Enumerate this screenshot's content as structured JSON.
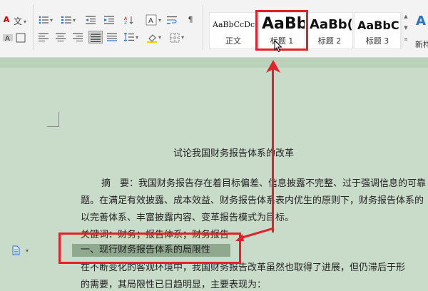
{
  "ribbon": {
    "style_gallery": [
      {
        "preview": "AaBbCcDc",
        "name": "正文"
      },
      {
        "preview": "AaBb",
        "name": "标题 1"
      },
      {
        "preview": "AaBb(",
        "name": "标题 2"
      },
      {
        "preview": "AaBbC",
        "name": "标题 3"
      },
      {
        "preview": "",
        "name": "新样"
      }
    ],
    "font_color_glyph": "A",
    "wen_glyph": "文",
    "style_glyph": "A"
  },
  "document": {
    "title": "试论我国财务报告体系的改革",
    "abstract_line1": "摘　要：我国财务报告存在着目标偏差、信息披露不完整、过于强调信息的可靠",
    "abstract_line2": "题。在满足有效披露、成本效益、财务报告体系表内优生的原则下，财务报告体系的",
    "abstract_line3": "以完善体系、丰富披露内容、变革报告模式为目标。",
    "keywords": "关键词：财务；报告体系；财务报告",
    "heading1": "一、现行财务报告体系的局限性",
    "body_line1": "在不断变化的客观环境中，我国财务报告改革虽然也取得了进展，但仍滞后于形",
    "body_line2": "的需要，其局限性已日趋明显，主要表现为："
  },
  "colors": {
    "highlight_red": "#e5202a",
    "page_green": "#c9dcc9",
    "heading_shade": "#8fa88e"
  }
}
